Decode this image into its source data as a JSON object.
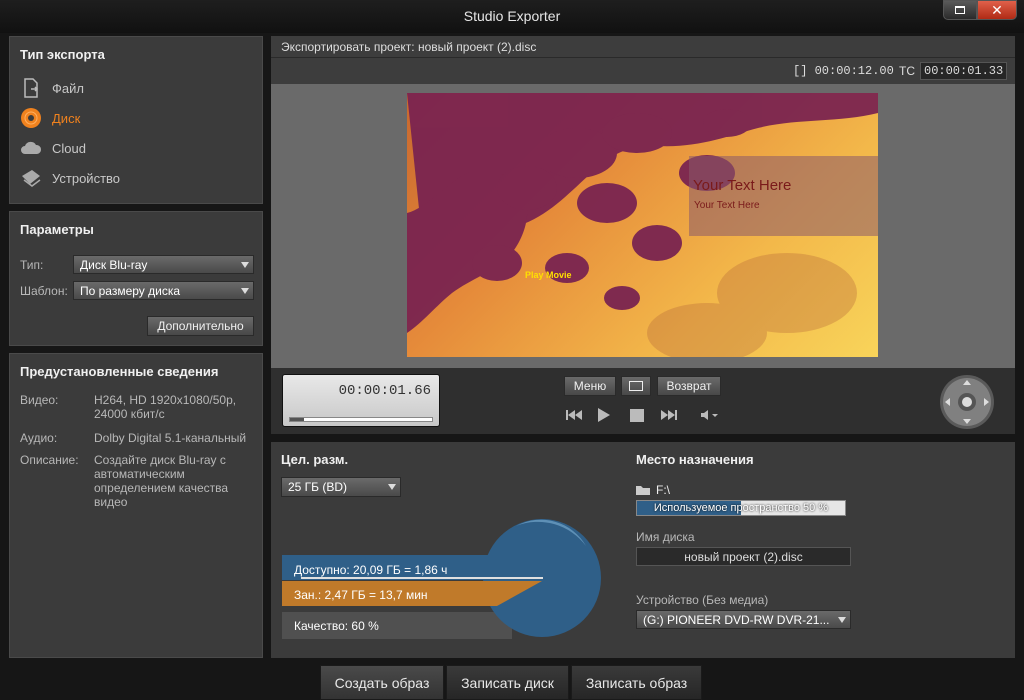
{
  "window": {
    "title": "Studio Exporter"
  },
  "export_type": {
    "title": "Тип экспорта",
    "items": [
      {
        "label": "Файл",
        "icon": "file-export-icon"
      },
      {
        "label": "Диск",
        "icon": "disc-icon",
        "active": true
      },
      {
        "label": "Cloud",
        "icon": "cloud-icon"
      },
      {
        "label": "Устройство",
        "icon": "device-icon"
      }
    ]
  },
  "params": {
    "title": "Параметры",
    "type_label": "Тип:",
    "type_value": "Диск Blu-ray",
    "template_label": "Шаблон:",
    "template_value": "По размеру диска",
    "advanced": "Дополнительно"
  },
  "preset": {
    "title": "Предустановленные сведения",
    "rows": [
      {
        "k": "Видео:",
        "v": "H264, HD 1920x1080/50p, 24000 кбит/с"
      },
      {
        "k": "Аудио:",
        "v": "Dolby Digital 5.1-канальный"
      },
      {
        "k": "Описание:",
        "v": "Создайте диск Blu-ray с автоматическим определением качества видео"
      }
    ]
  },
  "preview": {
    "header": "Экспортировать проект: новый проект (2).disc",
    "duration": "[] 00:00:12.00",
    "tc_label": "TC",
    "tc_value": "00:00:01.33",
    "title_big": "Your Text Here",
    "title_small": "Your Text Here",
    "play_movie": "Play Movie",
    "progress": 0.1
  },
  "transport": {
    "timecode": "00:00:01.66",
    "menu": "Меню",
    "back": "Возврат"
  },
  "target": {
    "title": "Цел. разм.",
    "size": "25 ГБ (BD)",
    "available": "Доступно: 20,09 ГБ = 1,86 ч",
    "used": "Зан.: 2,47 ГБ = 13,7 мин",
    "quality": "Качество:  60 %"
  },
  "dest": {
    "title": "Место назначения",
    "path": "F:\\",
    "space": "Используемое пространство 50 %",
    "space_fraction": 0.5,
    "disc_name_label": "Имя диска",
    "disc_name": "новый проект (2).disc",
    "device_label": "Устройство  (Без медиа)",
    "device": "(G:) PIONEER DVD-RW  DVR-21..."
  },
  "bottom": {
    "create_image": "Создать образ",
    "burn_disc": "Записать диск",
    "burn_image": "Записать образ"
  },
  "colors": {
    "accent": "#f0821e",
    "blue": "#2f5f88",
    "orange": "#c07a2a"
  }
}
